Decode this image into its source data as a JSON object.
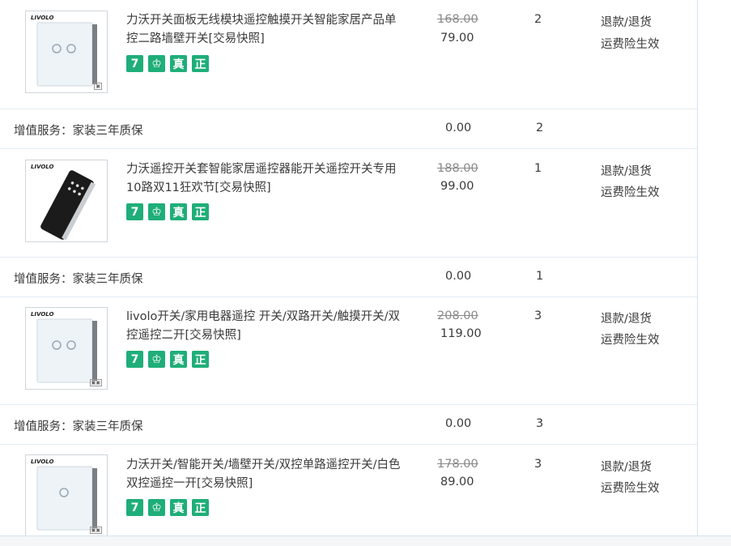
{
  "products": [
    {
      "title": "力沃开关面板无线模块遥控触摸开关智能家居产品单控二路墙壁开关[交易快照]",
      "old_price": "168.00",
      "price": "79.00",
      "qty": "2",
      "action_refund": "退款/退货",
      "action_insurance": "运费险生效",
      "brand": "LIVOLO",
      "image": "white-2-gang-switch",
      "service": {
        "label": "增值服务：家装三年质保",
        "price": "0.00",
        "qty": "2"
      }
    },
    {
      "title": "力沃遥控开关套智能家居遥控器能开关遥控开关专用10路双11狂欢节[交易快照]",
      "old_price": "188.00",
      "price": "99.00",
      "qty": "1",
      "action_refund": "退款/退货",
      "action_insurance": "运费险生效",
      "brand": "LIVOLO",
      "image": "black-remote-control",
      "service": {
        "label": "增值服务：家装三年质保",
        "price": "0.00",
        "qty": "1"
      }
    },
    {
      "title": "livolo开关/家用电器遥控 开关/双路开关/触摸开关/双控遥控二开[交易快照]",
      "old_price": "208.00",
      "price": "119.00",
      "qty": "3",
      "action_refund": "退款/退货",
      "action_insurance": "运费险生效",
      "brand": "LIVOLO",
      "image": "white-2-gang-switch",
      "service": {
        "label": "增值服务：家装三年质保",
        "price": "0.00",
        "qty": "3"
      }
    },
    {
      "title": "力沃开关/智能开关/墙壁开关/双控单路遥控开关/白色双控遥控一开[交易快照]",
      "old_price": "178.00",
      "price": "89.00",
      "qty": "3",
      "action_refund": "退款/退货",
      "action_insurance": "运费险生效",
      "brand": "LIVOLO",
      "image": "white-1-gang-switch"
    }
  ],
  "badges": [
    {
      "glyph": "7",
      "icon": "seven-day-return-icon"
    },
    {
      "glyph": "♔",
      "icon": "consumer-protection-icon"
    },
    {
      "glyph": "真",
      "icon": "authentic-icon"
    },
    {
      "glyph": "正",
      "icon": "genuine-icon"
    }
  ],
  "colors": {
    "badge": "#1fae79",
    "border": "#d6e4ef"
  }
}
